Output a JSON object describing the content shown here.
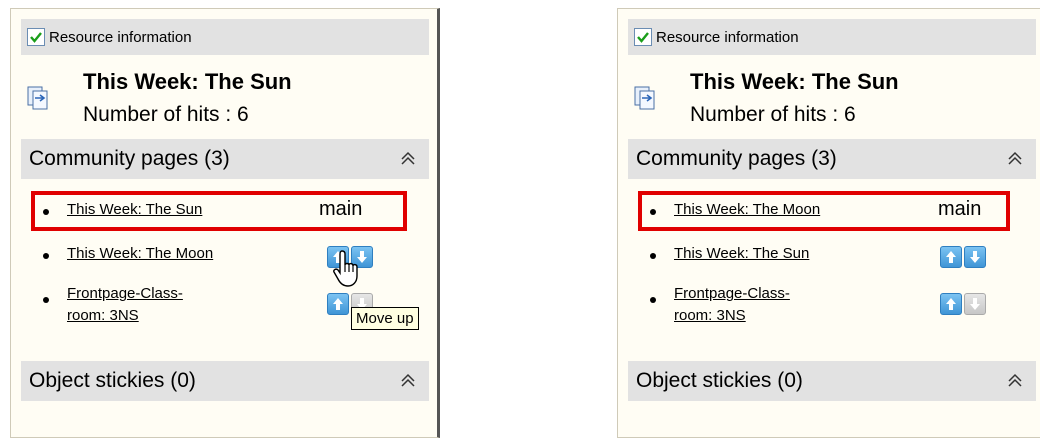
{
  "before": {
    "resource_label": "Resource information",
    "title": "This Week: The Sun",
    "hits": "Number of hits : 6",
    "community": {
      "label": "Community pages (3)"
    },
    "items": [
      {
        "label": "This Week: The Sun",
        "tag": "main"
      },
      {
        "label": "This Week: The Moon"
      },
      {
        "label_line1": "Frontpage-Class-",
        "label_line2": "room: 3NS"
      }
    ],
    "tooltip": "Move up",
    "stickies": "Object stickies (0)"
  },
  "after": {
    "resource_label": "Resource information",
    "title": "This Week: The Sun",
    "hits": "Number of hits : 6",
    "community": {
      "label": "Community pages (3)"
    },
    "items": [
      {
        "label": "This Week: The Moon",
        "tag": "main"
      },
      {
        "label": "This Week: The Sun"
      },
      {
        "label_line1": "Frontpage-Class-",
        "label_line2": "room: 3NS"
      }
    ],
    "stickies": "Object stickies (0)"
  },
  "colors": {
    "highlight": "#e00000",
    "button_active": "#3f95d6",
    "section_bg": "#e2e2e2"
  }
}
